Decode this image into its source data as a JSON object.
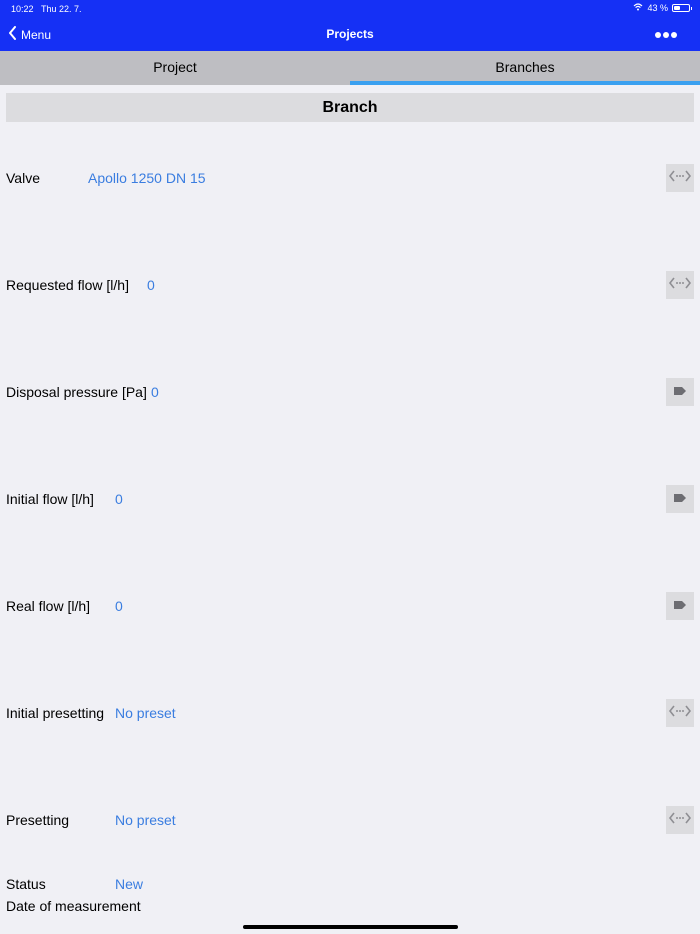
{
  "status_bar": {
    "time": "10:22",
    "date": "Thu 22. 7.",
    "battery": "43 %",
    "battery_level": 0.43
  },
  "nav": {
    "back_label": "Menu",
    "title": "Projects",
    "more_icon": "more-horizontal-icon"
  },
  "tabs": [
    {
      "label": "Project",
      "active": false
    },
    {
      "label": "Branches",
      "active": true
    }
  ],
  "section": {
    "title": "Branch"
  },
  "fields": {
    "valve": {
      "label": "Valve",
      "value": "Apollo 1250 DN 15",
      "icon": "swap-arrows-icon"
    },
    "requested_flow": {
      "label": "Requested flow [l/h]",
      "value": "0",
      "icon": "swap-arrows-icon"
    },
    "disposal_pressure": {
      "label": "Disposal pressure [Pa]",
      "value": "0",
      "icon": "tag-icon"
    },
    "initial_flow": {
      "label": "Initial flow [l/h]",
      "value": "0",
      "icon": "tag-icon"
    },
    "real_flow": {
      "label": "Real flow [l/h]",
      "value": "0",
      "icon": "tag-icon"
    },
    "initial_presetting": {
      "label": "Initial presetting",
      "value": "No preset",
      "icon": "swap-arrows-icon"
    },
    "presetting": {
      "label": "Presetting",
      "value": "No preset",
      "icon": "swap-arrows-icon"
    },
    "status": {
      "label": "Status",
      "value": "New"
    },
    "date_of_measurement": {
      "label": "Date of measurement"
    }
  },
  "colors": {
    "accent": "#1530f5",
    "value_text": "#3a7de0",
    "tab_indicator": "#3aa0f0"
  }
}
